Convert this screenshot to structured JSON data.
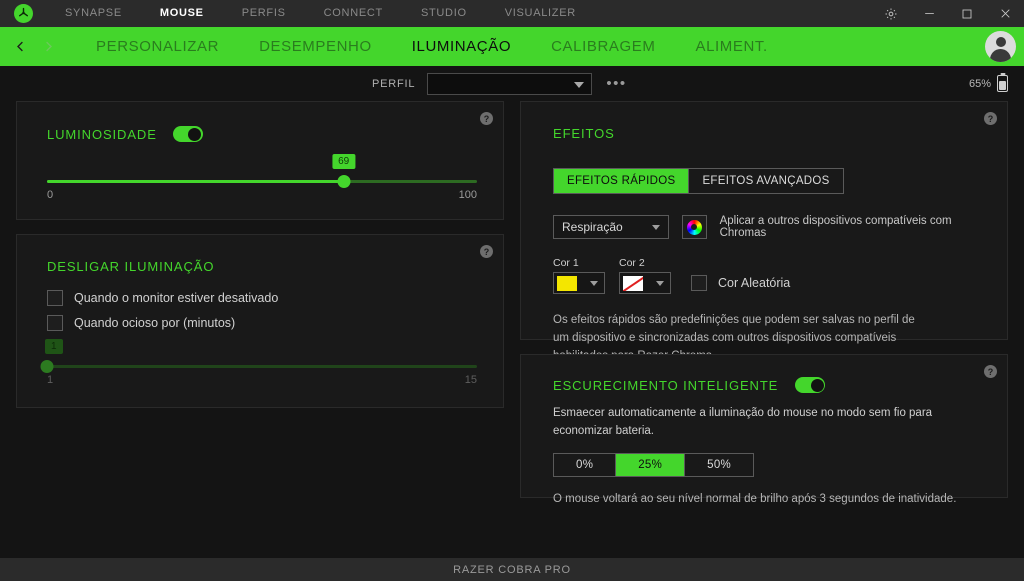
{
  "titlebar": {
    "logo_icon": "razer-logo-icon",
    "tabs": [
      {
        "label": "SYNAPSE",
        "active": false
      },
      {
        "label": "MOUSE",
        "active": true
      },
      {
        "label": "PERFIS",
        "active": false
      },
      {
        "label": "CONNECT",
        "active": false
      },
      {
        "label": "STUDIO",
        "active": false
      },
      {
        "label": "VISUALIZER",
        "active": false
      }
    ],
    "window_buttons": [
      {
        "name": "settings-gear-icon"
      },
      {
        "name": "minimize-icon"
      },
      {
        "name": "maximize-icon"
      },
      {
        "name": "close-icon"
      }
    ]
  },
  "navbar": {
    "back_icon": "chevron-left-icon",
    "forward_icon": "chevron-right-icon",
    "tabs": [
      {
        "label": "PERSONALIZAR",
        "active": false
      },
      {
        "label": "DESEMPENHO",
        "active": false
      },
      {
        "label": "ILUMINAÇÃO",
        "active": true
      },
      {
        "label": "CALIBRAGEM",
        "active": false
      },
      {
        "label": "ALIMENT.",
        "active": false
      }
    ],
    "avatar": "user-avatar"
  },
  "profile_bar": {
    "label": "PERFIL",
    "selected_profile": "",
    "placeholder": "",
    "more_options": "•••",
    "battery_percent": "65%"
  },
  "brightness_panel": {
    "title": "LUMINOSIDADE",
    "enabled": true,
    "value": 69,
    "min_label": "0",
    "max_label": "100",
    "help": "?"
  },
  "turn_off_panel": {
    "title": "DESLIGAR ILUMINAÇÃO",
    "help": "?",
    "options": [
      {
        "label": "Quando o monitor estiver desativado",
        "checked": false
      },
      {
        "label": "Quando ocioso por (minutos)",
        "checked": false
      }
    ],
    "idle_value": 1,
    "idle_min_label": "1",
    "idle_max_label": "15",
    "idle_enabled": false
  },
  "effects_panel": {
    "title": "EFEITOS",
    "help": "?",
    "tabs": [
      {
        "label": "EFEITOS RÁPIDOS",
        "active": true
      },
      {
        "label": "EFEITOS AVANÇADOS",
        "active": false
      }
    ],
    "effect_selected": "Respiração",
    "chroma_button_icon": "chroma-color-wheel-icon",
    "chroma_note": "Aplicar a outros dispositivos compatíveis com Chromas",
    "color1_label": "Cor 1",
    "color1_hex": "#f4e600",
    "color2_label": "Cor 2",
    "color2_hex": "none",
    "random_color_label": "Cor Aleatória",
    "random_color_checked": false,
    "description": "Os efeitos rápidos são predefinições que podem ser salvas no perfil de um dispositivo e sincronizadas com outros dispositivos compatíveis habilitados para Razer Chroma"
  },
  "smart_dim_panel": {
    "title": "ESCURECIMENTO INTELIGENTE",
    "help": "?",
    "enabled": true,
    "description": "Esmaecer automaticamente a iluminação do mouse no modo sem fio para economizar bateria.",
    "levels": [
      {
        "label": "0%",
        "active": false
      },
      {
        "label": "25%",
        "active": true
      },
      {
        "label": "50%",
        "active": false
      }
    ],
    "footnote": "O mouse voltará ao seu nível normal de brilho após 3 segundos de inatividade."
  },
  "footer": {
    "device_name": "RAZER COBRA PRO"
  },
  "colors": {
    "accent": "#44d62c",
    "panel_bg": "#191919",
    "app_bg": "#141414",
    "titlebar_bg": "#2b2b2b"
  }
}
